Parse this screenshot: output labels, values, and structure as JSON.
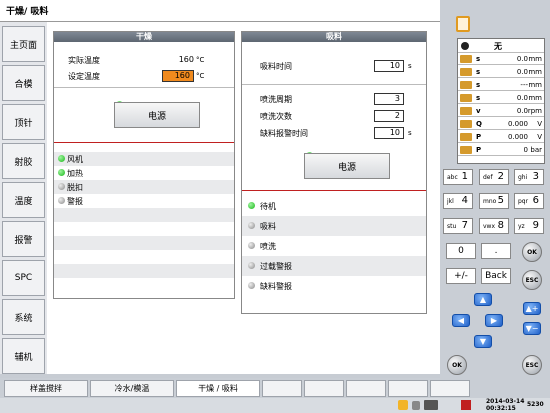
{
  "title": "干燥/ 吸料",
  "sidebar": [
    "主页面",
    "合模",
    "顶针",
    "射胶",
    "温度",
    "报警",
    "SPC",
    "系统",
    "辅机"
  ],
  "dry": {
    "title": "干燥",
    "actual_label": "实际温度",
    "actual_value": "160",
    "set_label": "设定温度",
    "set_value": "160",
    "unit": "°C",
    "power_label": "电源",
    "status": [
      {
        "label": "风机",
        "led": "green"
      },
      {
        "label": "加热",
        "led": "green"
      },
      {
        "label": "脱扣",
        "led": "gray"
      },
      {
        "label": "警报",
        "led": "gray"
      }
    ]
  },
  "suck": {
    "title": "吸料",
    "time_label": "吸料时间",
    "time_value": "10",
    "time_unit": "s",
    "cycle_label": "喷洗周期",
    "cycle_value": "3",
    "count_label": "喷洗次数",
    "count_value": "2",
    "alarm_label": "缺料报警时间",
    "alarm_value": "10",
    "alarm_unit": "s",
    "power_label": "电源",
    "status": [
      {
        "label": "待机",
        "led": "green"
      },
      {
        "label": "吸料",
        "led": "gray"
      },
      {
        "label": "喷洗",
        "led": "gray"
      },
      {
        "label": "过载警报",
        "led": "gray"
      },
      {
        "label": "缺料警报",
        "led": "gray"
      }
    ]
  },
  "right_panel": {
    "header": "无",
    "rows": [
      {
        "label": "s",
        "value": "0.0",
        "unit": "mm"
      },
      {
        "label": "s",
        "value": "0.0",
        "unit": "mm"
      },
      {
        "label": "s",
        "value": "---",
        "unit": "mm"
      },
      {
        "label": "s",
        "value": "0.0",
        "unit": "mm"
      },
      {
        "label": "v",
        "value": "0.0",
        "unit": "rpm"
      },
      {
        "label": "Q",
        "value": "0.000",
        "unit": "V"
      },
      {
        "label": "P",
        "value": "0.000",
        "unit": "V"
      },
      {
        "label": "P",
        "value": "0",
        "unit": "bar"
      }
    ]
  },
  "keypad": {
    "keys": [
      {
        "m": "abc",
        "n": "1"
      },
      {
        "m": "def",
        "n": "2"
      },
      {
        "m": "ghi",
        "n": "3"
      },
      {
        "m": "jkl",
        "n": "4"
      },
      {
        "m": "mno",
        "n": "5"
      },
      {
        "m": "pqr",
        "n": "6"
      },
      {
        "m": "stu",
        "n": "7"
      },
      {
        "m": "vwx",
        "n": "8"
      },
      {
        "m": "yz",
        "n": "9"
      }
    ],
    "zero": "0",
    "dot": ".",
    "plusminus": "+/-",
    "back": "Back",
    "ok": "OK",
    "esc": "ESC"
  },
  "bottom_tabs": [
    "样盖搅拌",
    "冷水/模温",
    "干燥 / 吸料",
    "",
    "",
    "",
    "",
    ""
  ],
  "status_bar": {
    "date": "2014-03-14",
    "time": "00:32:15",
    "code": "5230"
  }
}
